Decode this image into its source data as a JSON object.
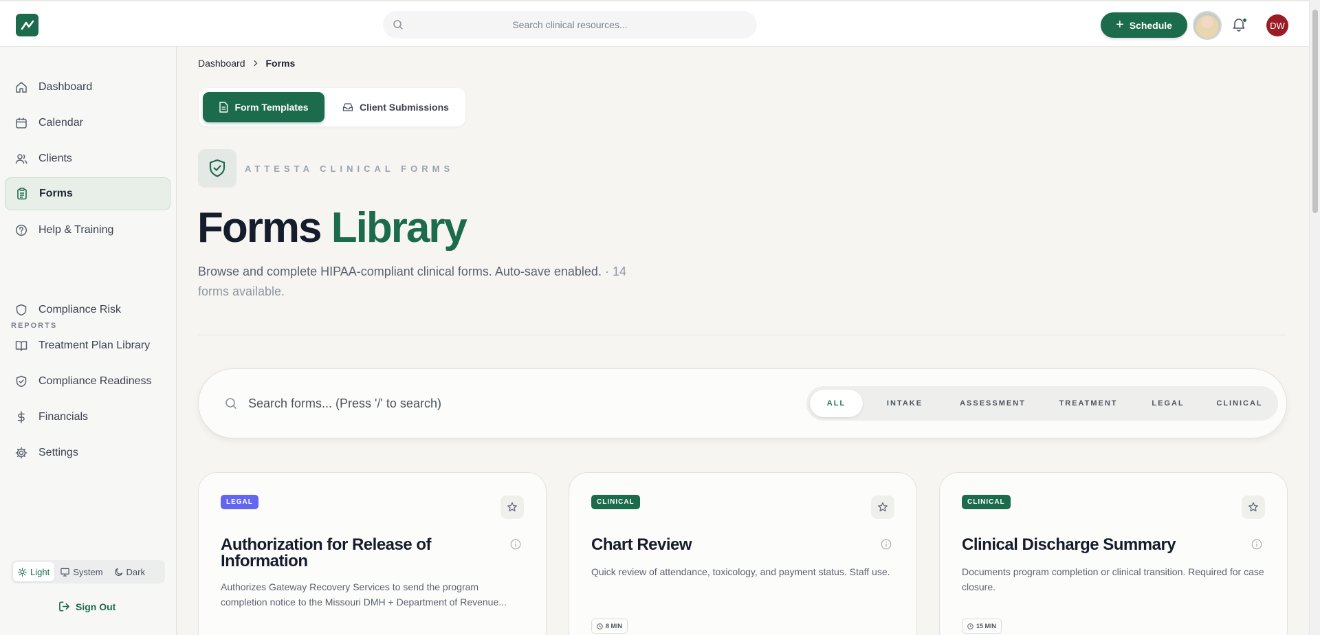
{
  "topbar": {
    "search_placeholder": "Search clinical resources...",
    "schedule_label": "Schedule",
    "user_initials": "DW"
  },
  "sidebar": {
    "items": [
      {
        "label": "Dashboard",
        "icon": "home-icon"
      },
      {
        "label": "Calendar",
        "icon": "calendar-icon"
      },
      {
        "label": "Clients",
        "icon": "users-icon"
      },
      {
        "label": "Forms",
        "icon": "clipboard-icon",
        "active": true
      },
      {
        "label": "Help & Training",
        "icon": "help-circle-icon"
      }
    ],
    "reports_label": "REPORTS",
    "report_items": [
      {
        "label": "Compliance Risk",
        "icon": "shield-icon"
      },
      {
        "label": "Treatment Plan Library",
        "icon": "book-icon"
      },
      {
        "label": "Compliance Readiness",
        "icon": "shield-check-icon"
      },
      {
        "label": "Financials",
        "icon": "dollar-icon"
      },
      {
        "label": "Settings",
        "icon": "gear-icon"
      }
    ],
    "theme": {
      "light": "Light",
      "system": "System",
      "dark": "Dark",
      "selected": "Light"
    },
    "sign_out": "Sign Out"
  },
  "breadcrumb": {
    "root": "Dashboard",
    "current": "Forms"
  },
  "tabs": {
    "templates": "Form Templates",
    "submissions": "Client Submissions",
    "active": "templates"
  },
  "header": {
    "eyebrow": "ATTESTA CLINICAL FORMS",
    "title_main": "Forms",
    "title_accent": "Library",
    "subtitle": "Browse and complete HIPAA-compliant clinical forms. Auto-save enabled.",
    "count": "· 14 forms available."
  },
  "filters": {
    "search_placeholder": "Search forms... (Press '/' to search)",
    "categories": [
      "ALL",
      "INTAKE",
      "ASSESSMENT",
      "TREATMENT",
      "LEGAL",
      "CLINICAL"
    ],
    "selected": "ALL"
  },
  "cards": [
    {
      "badge": "LEGAL",
      "badge_color": "#6366f1",
      "title": "Authorization for Release of Information",
      "description": "Authorizes Gateway Recovery Services to send the program completion notice to the Missouri DMH + Department of Revenue..."
    },
    {
      "badge": "CLINICAL",
      "badge_color": "#1c6b4d",
      "title": "Chart Review",
      "description": "Quick review of attendance, toxicology, and payment status. Staff use.",
      "duration": "8 MIN"
    },
    {
      "badge": "CLINICAL",
      "badge_color": "#1c6b4d",
      "title": "Clinical Discharge Summary",
      "description": "Documents program completion or clinical transition. Required for case closure.",
      "duration": "15 MIN"
    }
  ],
  "colors": {
    "brand": "#1c6b4d",
    "legal_badge": "#6366f1",
    "avatar_bg": "#9b1c24"
  }
}
